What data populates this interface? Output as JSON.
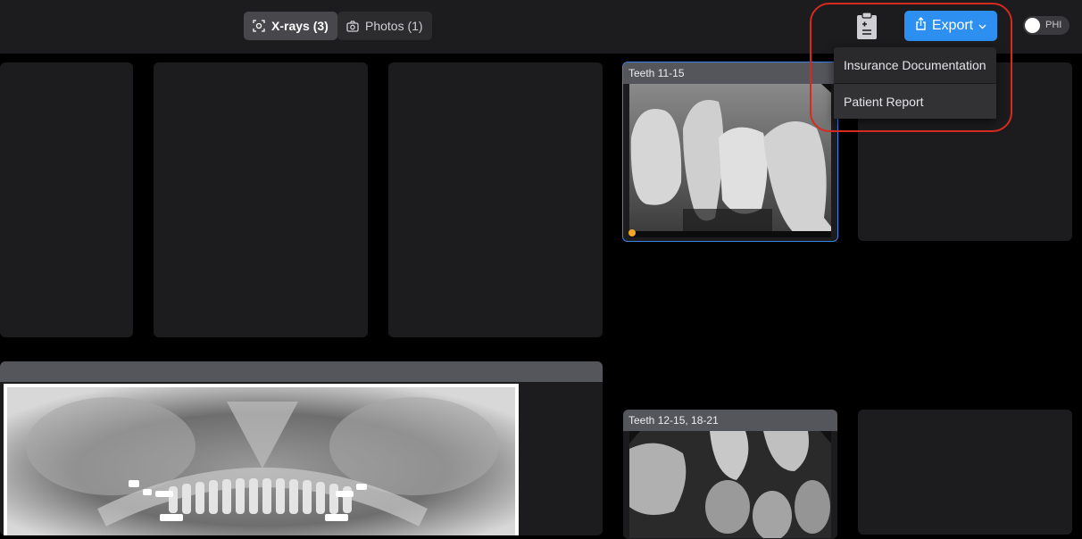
{
  "tabs": [
    {
      "label": "X-rays (3)",
      "icon": "xray-scan-icon",
      "active": true
    },
    {
      "label": "Photos (1)",
      "icon": "camera-icon",
      "active": false
    }
  ],
  "toolbar": {
    "clipboard_icon": "clipboard-report-icon",
    "export_label": "Export",
    "export_icon": "share-export-icon",
    "phi_label": "PHI",
    "phi_on": false
  },
  "export_menu": {
    "items": [
      "Insurance Documentation",
      "Patient Report"
    ]
  },
  "xray_cards": [
    {
      "label": "Teeth 11-15",
      "selected": true,
      "flagged": true
    },
    {
      "label": "Teeth 12-15, 18-21",
      "selected": false,
      "flagged": false
    }
  ],
  "colors": {
    "accent": "#2d8ff0",
    "highlight": "#d72a1e",
    "flag": "#f5a623",
    "selection": "#3c83e0"
  }
}
